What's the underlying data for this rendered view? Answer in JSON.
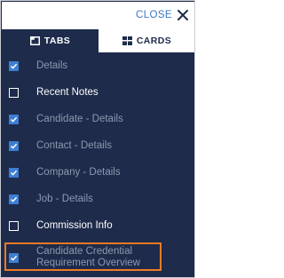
{
  "header": {
    "close_label": "CLOSE"
  },
  "tabs": [
    {
      "label": "TABS",
      "icon": "tab-window-icon",
      "active": false
    },
    {
      "label": "CARDS",
      "icon": "cards-grid-icon",
      "active": true
    }
  ],
  "items": [
    {
      "label": "Details",
      "checked": true
    },
    {
      "label": "Recent Notes",
      "checked": false
    },
    {
      "label": "Candidate - Details",
      "checked": true
    },
    {
      "label": "Contact - Details",
      "checked": true
    },
    {
      "label": "Company - Details",
      "checked": true
    },
    {
      "label": "Job - Details",
      "checked": true
    },
    {
      "label": "Commission Info",
      "checked": false
    },
    {
      "label": "Candidate Credential\nRequirement Overview",
      "checked": true
    }
  ],
  "colors": {
    "panel_bg": "#1e2b4b",
    "accent": "#3d7fd3",
    "close_text": "#3b78c4",
    "highlight_border": "#f07b25"
  }
}
